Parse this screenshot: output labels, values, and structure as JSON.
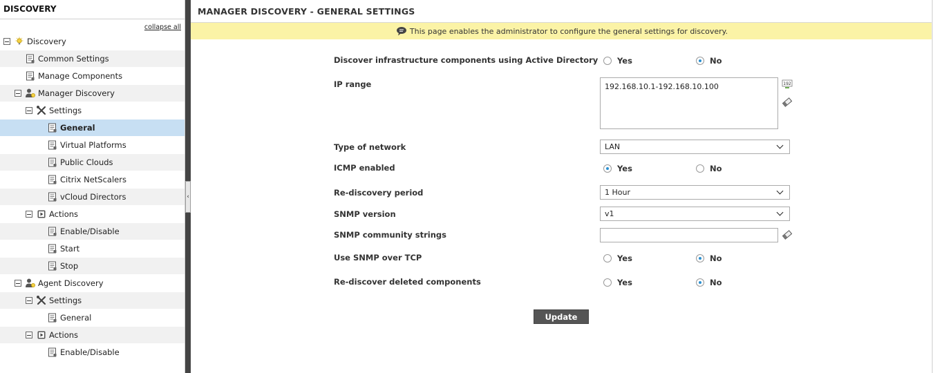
{
  "sidebar": {
    "title": "DISCOVERY",
    "collapse_label": "collapse all",
    "items": [
      {
        "label": "Discovery"
      },
      {
        "label": "Common Settings"
      },
      {
        "label": "Manage Components"
      },
      {
        "label": "Manager Discovery"
      },
      {
        "label": "Settings"
      },
      {
        "label": "General"
      },
      {
        "label": "Virtual Platforms"
      },
      {
        "label": "Public Clouds"
      },
      {
        "label": "Citrix NetScalers"
      },
      {
        "label": "vCloud Directors"
      },
      {
        "label": "Actions"
      },
      {
        "label": "Enable/Disable"
      },
      {
        "label": "Start"
      },
      {
        "label": "Stop"
      },
      {
        "label": "Agent Discovery"
      },
      {
        "label": "Settings"
      },
      {
        "label": "General"
      },
      {
        "label": "Actions"
      },
      {
        "label": "Enable/Disable"
      }
    ],
    "selected_item": "General"
  },
  "main": {
    "title": "MANAGER DISCOVERY - GENERAL SETTINGS",
    "info_text": "This page enables the administrator to configure the general settings for discovery.",
    "form": {
      "active_directory": {
        "label": "Discover infrastructure components using Active Directory",
        "yes": "Yes",
        "no": "No",
        "value": "No"
      },
      "ip_range": {
        "label": "IP range",
        "value": "192.168.10.1-192.168.10.100"
      },
      "network_type": {
        "label": "Type of network",
        "value": "LAN"
      },
      "icmp": {
        "label": "ICMP enabled",
        "yes": "Yes",
        "no": "No",
        "value": "Yes"
      },
      "rediscovery_period": {
        "label": "Re-discovery period",
        "value": "1 Hour"
      },
      "snmp_version": {
        "label": "SNMP version",
        "value": "v1"
      },
      "snmp_community": {
        "label": "SNMP community strings",
        "value": ""
      },
      "snmp_tcp": {
        "label": "Use SNMP over TCP",
        "yes": "Yes",
        "no": "No",
        "value": "No"
      },
      "rediscover_deleted": {
        "label": "Re-discover deleted components",
        "yes": "Yes",
        "no": "No",
        "value": "No"
      }
    },
    "update_label": "Update"
  },
  "colors": {
    "selected_row": "#c7dff3",
    "info_bar": "#fbf3a6",
    "radio_accent": "#2a8fd0",
    "button": "#555555"
  },
  "icons": {
    "discovery": "lightbulb-icon",
    "page": "page-icon",
    "manager": "user-bulb-icon",
    "settings": "wrench-screwdriver-icon",
    "actions": "play-box-icon",
    "info": "speech-bubble-icon",
    "ip_helper": "ip-192-icon",
    "eraser": "eraser-icon"
  }
}
